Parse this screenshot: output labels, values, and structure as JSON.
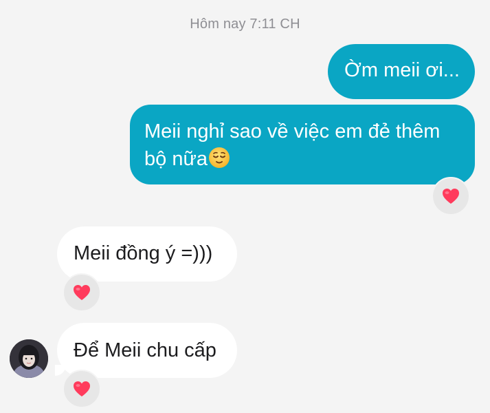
{
  "conversation": {
    "timestamp": "Hôm nay 7:11 CH",
    "messages": [
      {
        "direction": "outgoing",
        "text": "Ờm meii ơi..."
      },
      {
        "direction": "outgoing",
        "text": "Meii nghỉ sao về việc em đẻ thêm bộ nữa",
        "emoji": "relieved-face-emoji",
        "reaction": "heart"
      },
      {
        "direction": "incoming",
        "text": "Meii đồng ý =)))",
        "reaction": "heart"
      },
      {
        "direction": "incoming",
        "text": "Để Meii chu cấp",
        "reaction": "heart"
      }
    ]
  },
  "colors": {
    "background": "#f4f4f4",
    "outgoing_bubble": "#0aa6c4",
    "incoming_bubble": "#ffffff",
    "reaction_heart": "#ff3b5c",
    "timestamp_text": "#8e8e93"
  }
}
